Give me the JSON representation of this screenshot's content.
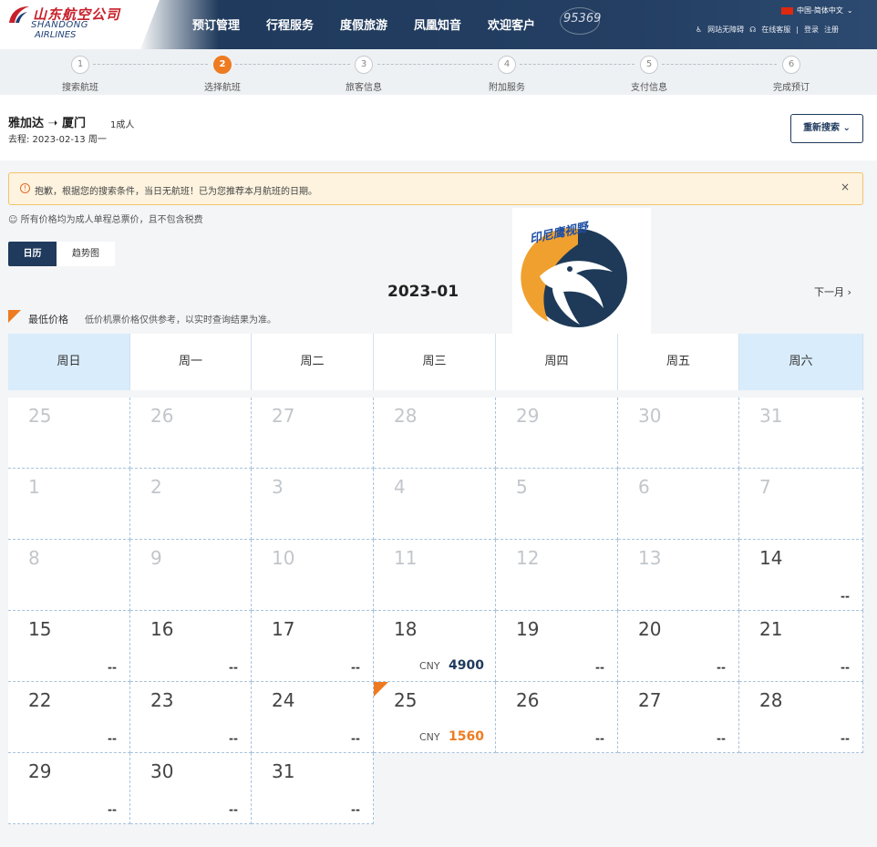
{
  "header": {
    "logo_cn": "山东航空公司",
    "logo_en_line1": "SHANDONG",
    "logo_en_line2": "AIRLINES",
    "nav": [
      "预订管理",
      "行程服务",
      "度假旅游",
      "凤凰知音",
      "欢迎客户"
    ],
    "hotline": "95369",
    "language": "中国-简体中文",
    "accessibility": "网站无障碍",
    "online_service": "在线客服",
    "login": "登录",
    "separator": "|",
    "register": "注册"
  },
  "steps": [
    {
      "num": "1",
      "label": "搜索航班"
    },
    {
      "num": "2",
      "label": "选择航班"
    },
    {
      "num": "3",
      "label": "旅客信息"
    },
    {
      "num": "4",
      "label": "附加服务"
    },
    {
      "num": "5",
      "label": "支付信息"
    },
    {
      "num": "6",
      "label": "完成预订"
    }
  ],
  "active_step": 2,
  "trip": {
    "route": "雅加达 ➝ 厦门",
    "passengers": "1成人",
    "date": "去程:  2023-02-13 周一",
    "research_label": "重新搜索"
  },
  "alert": {
    "icon": "!",
    "text": "抱歉，根据您的搜索条件，当日无航班！已为您推荐本月航班的日期。",
    "close": "×"
  },
  "note": "所有价格均为成人单程总票价，且不包含税费",
  "tabs": {
    "calendar": "日历",
    "trend": "趋势图"
  },
  "month": "2023-01",
  "next_month": "下一月",
  "legend": {
    "label": "最低价格",
    "note": "低价机票价格仅供参考，以实时查询结果为准。"
  },
  "watermark_text": "印尼鹰视野",
  "weekdays": [
    "周日",
    "周一",
    "周二",
    "周三",
    "周四",
    "周五",
    "周六"
  ],
  "weeks": [
    [
      {
        "d": "25",
        "dim": true
      },
      {
        "d": "26",
        "dim": true
      },
      {
        "d": "27",
        "dim": true
      },
      {
        "d": "28",
        "dim": true
      },
      {
        "d": "29",
        "dim": true
      },
      {
        "d": "30",
        "dim": true
      },
      {
        "d": "31",
        "dim": true
      }
    ],
    [
      {
        "d": "1",
        "dim": true
      },
      {
        "d": "2",
        "dim": true
      },
      {
        "d": "3",
        "dim": true
      },
      {
        "d": "4",
        "dim": true
      },
      {
        "d": "5",
        "dim": true
      },
      {
        "d": "6",
        "dim": true
      },
      {
        "d": "7",
        "dim": true
      }
    ],
    [
      {
        "d": "8",
        "dim": true
      },
      {
        "d": "9",
        "dim": true
      },
      {
        "d": "10",
        "dim": true
      },
      {
        "d": "11",
        "dim": true
      },
      {
        "d": "12",
        "dim": true
      },
      {
        "d": "13",
        "dim": true
      },
      {
        "d": "14",
        "p": "--"
      }
    ],
    [
      {
        "d": "15",
        "p": "--"
      },
      {
        "d": "16",
        "p": "--"
      },
      {
        "d": "17",
        "p": "--"
      },
      {
        "d": "18",
        "cur": "CNY",
        "pv": "4900",
        "col": "#1f3a5c"
      },
      {
        "d": "19",
        "p": "--"
      },
      {
        "d": "20",
        "p": "--"
      },
      {
        "d": "21",
        "p": "--"
      }
    ],
    [
      {
        "d": "22",
        "p": "--"
      },
      {
        "d": "23",
        "p": "--"
      },
      {
        "d": "24",
        "p": "--"
      },
      {
        "d": "25",
        "cur": "CNY",
        "pv": "1560",
        "col": "#ee7b21",
        "low": true
      },
      {
        "d": "26",
        "p": "--"
      },
      {
        "d": "27",
        "p": "--"
      },
      {
        "d": "28",
        "p": "--"
      }
    ],
    [
      {
        "d": "29",
        "p": "--"
      },
      {
        "d": "30",
        "p": "--"
      },
      {
        "d": "31",
        "p": "--"
      }
    ]
  ],
  "colors": {
    "accent": "#ee7b21",
    "navy": "#1f3a5c",
    "weekend_header": "#d9ecfb"
  }
}
